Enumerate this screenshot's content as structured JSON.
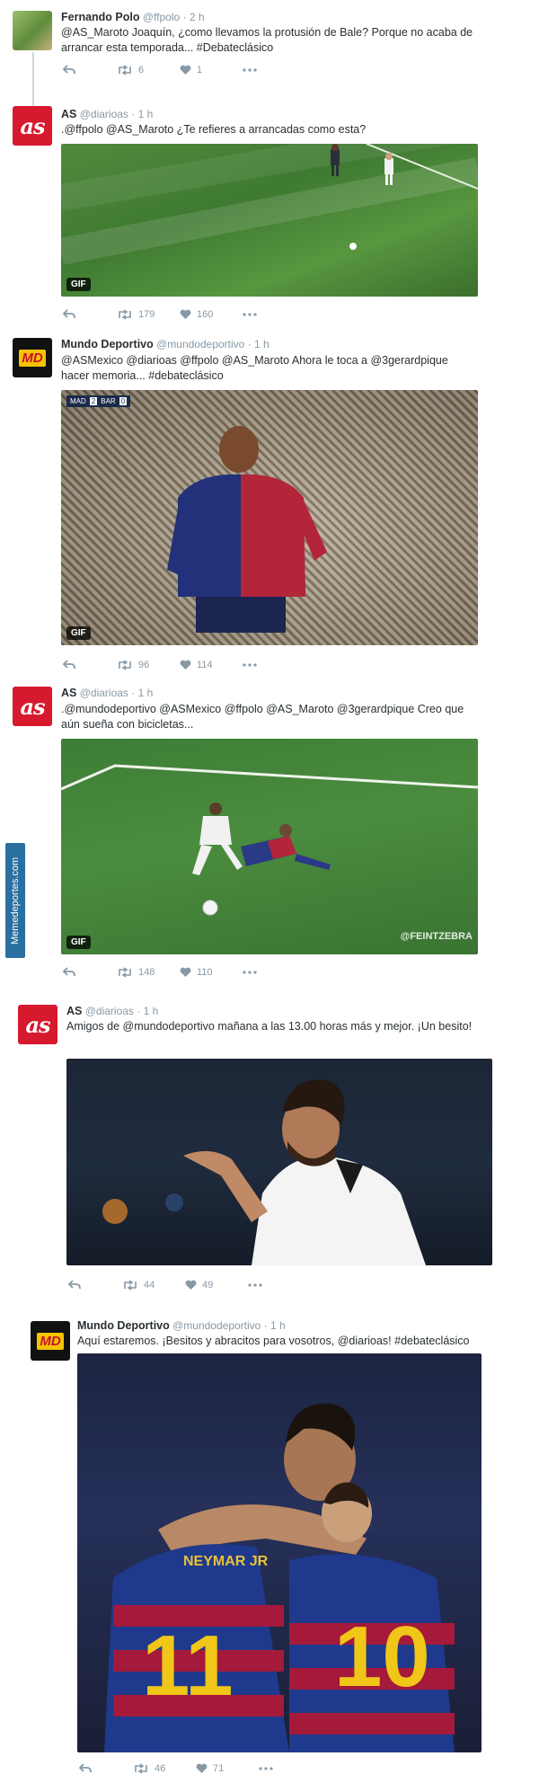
{
  "watermark": "Memedeportes.com",
  "tweets": [
    {
      "name": "Fernando Polo",
      "handle": "@ffpolo",
      "time": "2 h",
      "text": "@AS_Maroto Joaquín, ¿como llevamos la protusión de Bale? Porque no acaba de arrancar esta temporada... #Debateclásico",
      "retweets": "6",
      "likes": "1"
    },
    {
      "name": "AS",
      "handle": "@diarioas",
      "time": "1 h",
      "text": ".@ffpolo @AS_Maroto ¿Te refieres a arrancadas como esta?",
      "media_badge": "GIF",
      "retweets": "179",
      "likes": "160"
    },
    {
      "name": "Mundo Deportivo",
      "handle": "@mundodeportivo",
      "time": "1 h",
      "text": "@ASMexico @diarioas @ffpolo @AS_Maroto Ahora le toca a @3gerardpique hacer memoria... #debateclásico",
      "media_badge": "GIF",
      "retweets": "96",
      "likes": "114"
    },
    {
      "name": "AS",
      "handle": "@diarioas",
      "time": "1 h",
      "text": ".@mundodeportivo @ASMexico @ffpolo @AS_Maroto @3gerardpique Creo que aún sueña con bicicletas...",
      "media_badge": "GIF",
      "media_credit": "@FEINTZEBRA",
      "retweets": "148",
      "likes": "110"
    },
    {
      "name": "AS",
      "handle": "@diarioas",
      "time": "1 h",
      "text": "Amigos de @mundodeportivo mañana a las 13.00 horas más y mejor. ¡Un besito!",
      "retweets": "44",
      "likes": "49"
    },
    {
      "name": "Mundo Deportivo",
      "handle": "@mundodeportivo",
      "time": "1 h",
      "text": "Aquí estaremos. ¡Besitos y abracitos para vosotros, @diarioas! #debateclásico",
      "retweets": "46",
      "likes": "71"
    }
  ],
  "avatar_labels": {
    "as": "as",
    "md": "MD"
  },
  "scoreboard": {
    "team1": "MAD",
    "score1": "2",
    "team2": "BAR",
    "score2": "0"
  },
  "jerseys": {
    "left": "11",
    "right": "10",
    "name": "NEYMAR JR"
  },
  "colors": {
    "accent": "#d7192d",
    "meta": "#8899a6",
    "text": "#292f33"
  }
}
